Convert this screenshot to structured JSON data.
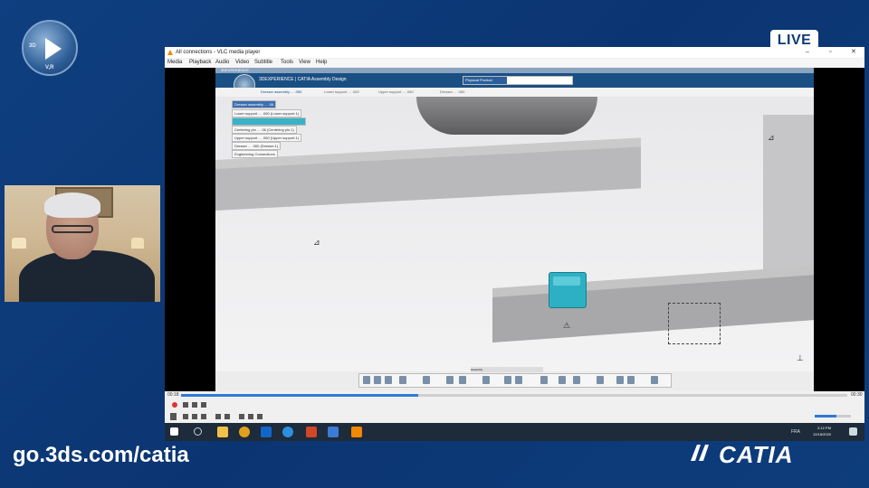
{
  "overlay": {
    "live_badge": "LIVE",
    "url": "go.3ds.com/catia",
    "brand": "CATIA",
    "ds_mark": "3DS"
  },
  "vlc": {
    "window_title": "All connections - VLC media player",
    "menu": [
      "Media",
      "Playback",
      "Audio",
      "Video",
      "Subtitle",
      "Tools",
      "View",
      "Help"
    ],
    "time_elapsed": "00:18",
    "time_total": "00:30"
  },
  "catia": {
    "app_name": "3DEXPERIENCE | CATIA Assembly Design",
    "search_scope": "Physical Product",
    "tabs": [
      "Dresser assembly ... .060",
      "Lower support ... .060",
      "Upper support ... .060",
      "Dresser ... .060"
    ],
    "tree": [
      "Dresser assembly ... .06",
      "Lower support ... .060 (Lower support.1)",
      "",
      "Centering pin ... .06 (Centering pin.1)",
      "Upper support ... .060 (Upper support.1)",
      "Dresser ... .060 (Dresser.1)",
      "Engineering Connections"
    ],
    "toolbar_tab": "Assembly"
  },
  "taskbar": {
    "lang": "FRA",
    "time": "2:12 PM",
    "date": "12/18/2020"
  },
  "colors": {
    "background": "#0e3a78",
    "catia_bar": "#1a4f84",
    "highlight": "#38b2c6",
    "seek": "#2e7bd6"
  }
}
